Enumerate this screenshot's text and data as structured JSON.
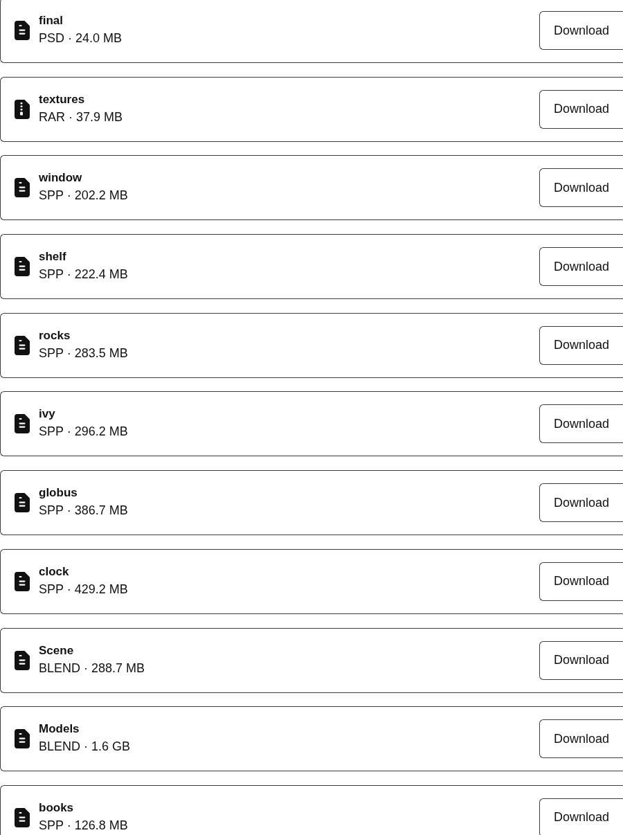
{
  "files": [
    {
      "kind": "document",
      "name": "final",
      "details": "PSD · 24.0 MB",
      "button": "Download"
    },
    {
      "kind": "archive",
      "name": "textures",
      "details": "RAR · 37.9 MB",
      "button": "Download"
    },
    {
      "kind": "document",
      "name": "window",
      "details": "SPP · 202.2 MB",
      "button": "Download"
    },
    {
      "kind": "document",
      "name": "shelf",
      "details": "SPP · 222.4 MB",
      "button": "Download"
    },
    {
      "kind": "document",
      "name": "rocks",
      "details": "SPP · 283.5 MB",
      "button": "Download"
    },
    {
      "kind": "document",
      "name": "ivy",
      "details": "SPP · 296.2 MB",
      "button": "Download"
    },
    {
      "kind": "document",
      "name": "globus",
      "details": "SPP · 386.7 MB",
      "button": "Download"
    },
    {
      "kind": "document",
      "name": "clock",
      "details": "SPP · 429.2 MB",
      "button": "Download"
    },
    {
      "kind": "document",
      "name": "Scene",
      "details": "BLEND · 288.7 MB",
      "button": "Download"
    },
    {
      "kind": "document",
      "name": "Models",
      "details": "BLEND · 1.6 GB",
      "button": "Download"
    },
    {
      "kind": "document",
      "name": "books",
      "details": "SPP · 126.8 MB",
      "button": "Download"
    }
  ]
}
